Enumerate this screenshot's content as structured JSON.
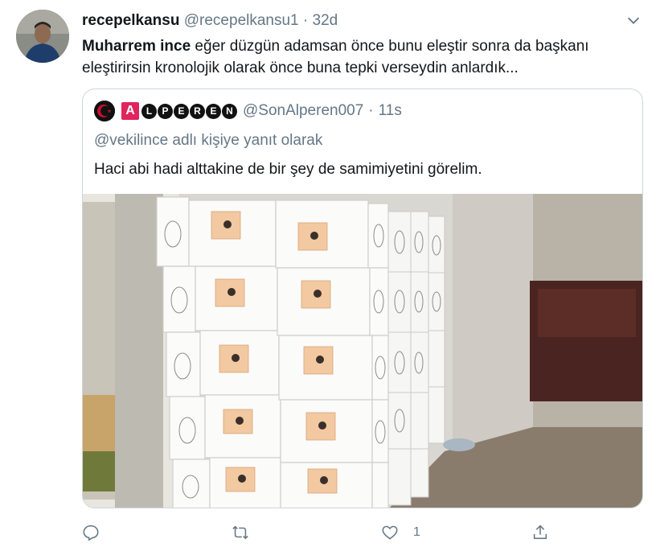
{
  "tweet": {
    "display_name": "recepelkansu",
    "handle": "@recepelkansu1",
    "separator": "·",
    "time": "32d",
    "text_mention": "Muharrem ince",
    "text_body": " eğer düzgün adamsan önce bunu eleştir sonra da başkanı eleştirirsin kronolojik olarak önce buna tepki verseydin anlardık..."
  },
  "quote": {
    "badge_letter": "A",
    "name_letters": [
      "L",
      "P",
      "E",
      "R",
      "E",
      "N"
    ],
    "handle": "@SonAlperen007",
    "separator": "·",
    "time": "11s",
    "replying_to": "@vekilince adlı kişiye yanıt olarak",
    "text": "Haci abi hadi alttakine de bir şey de samimiyetini görelim."
  },
  "actions": {
    "reply_icon": "reply-icon",
    "retweet_icon": "retweet-icon",
    "like_icon": "heart-icon",
    "like_count": "1",
    "share_icon": "share-icon"
  },
  "colors": {
    "text_primary": "#14171a",
    "text_secondary": "#657786",
    "border": "#ccd6dd",
    "badge_red": "#e0245e"
  }
}
